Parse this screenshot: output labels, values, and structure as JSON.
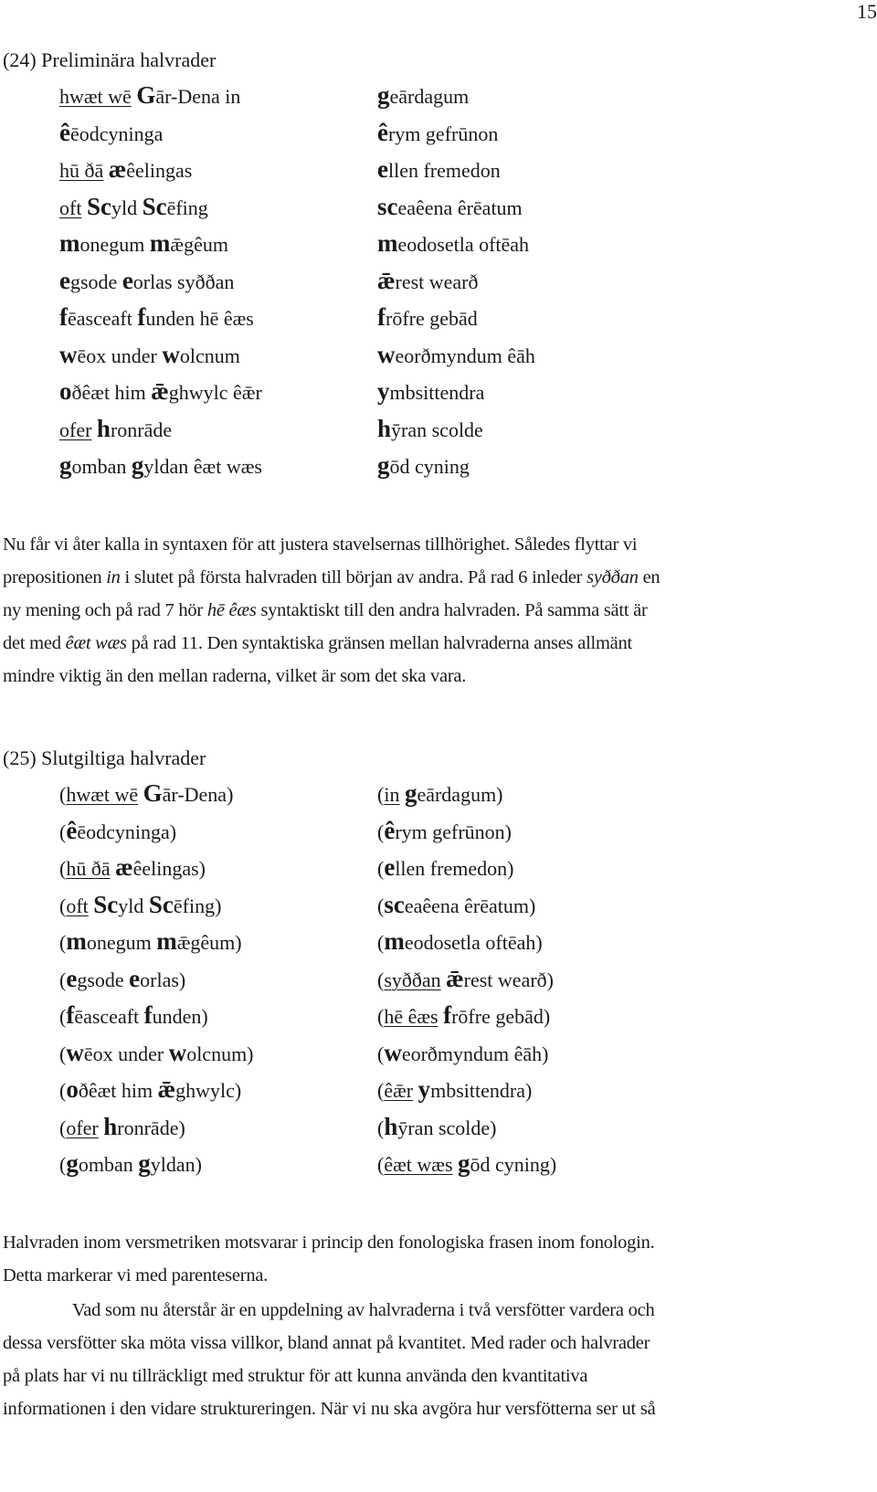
{
  "page_number": "15",
  "example_24": {
    "title": "(24) Preliminära halvrader",
    "rows": [
      {
        "a": [
          [
            "u",
            "hwæt wē"
          ],
          [
            "t",
            " "
          ],
          [
            "b",
            "G"
          ],
          [
            "t",
            "ār-Dena in"
          ]
        ],
        "b": [
          [
            "b",
            "g"
          ],
          [
            "t",
            "eārdagum"
          ]
        ]
      },
      {
        "a": [
          [
            "b",
            "ê"
          ],
          [
            "t",
            "ēodcyninga"
          ]
        ],
        "b": [
          [
            "b",
            "ê"
          ],
          [
            "t",
            "rym gefrūnon"
          ]
        ]
      },
      {
        "a": [
          [
            "u",
            "hū ðā"
          ],
          [
            "t",
            " "
          ],
          [
            "b",
            "æ"
          ],
          [
            "t",
            "êelingas"
          ]
        ],
        "b": [
          [
            "b",
            "e"
          ],
          [
            "t",
            "llen fremedon"
          ]
        ]
      },
      {
        "a": [
          [
            "u",
            "oft"
          ],
          [
            "t",
            " "
          ],
          [
            "b",
            "Sc"
          ],
          [
            "t",
            "yld "
          ],
          [
            "b",
            "Sc"
          ],
          [
            "t",
            "ēfing"
          ]
        ],
        "b": [
          [
            "b",
            "sc"
          ],
          [
            "t",
            "eaêena êrēatum"
          ]
        ]
      },
      {
        "a": [
          [
            "b",
            "m"
          ],
          [
            "t",
            "onegum "
          ],
          [
            "b",
            "m"
          ],
          [
            "t",
            "ǣgêum"
          ]
        ],
        "b": [
          [
            "b",
            "m"
          ],
          [
            "t",
            "eodosetla oftēah"
          ]
        ]
      },
      {
        "a": [
          [
            "b",
            "e"
          ],
          [
            "t",
            "gsode "
          ],
          [
            "b",
            "e"
          ],
          [
            "t",
            "orlas syððan"
          ]
        ],
        "b": [
          [
            "b",
            "ǣ"
          ],
          [
            "t",
            "rest wearð"
          ]
        ]
      },
      {
        "a": [
          [
            "b",
            "f"
          ],
          [
            "t",
            "ēasceaft "
          ],
          [
            "b",
            "f"
          ],
          [
            "t",
            "unden hē êæs"
          ]
        ],
        "b": [
          [
            "b",
            "f"
          ],
          [
            "t",
            "rōfre gebād"
          ]
        ]
      },
      {
        "a": [
          [
            "b",
            "w"
          ],
          [
            "t",
            "ēox under "
          ],
          [
            "b",
            "w"
          ],
          [
            "t",
            "olcnum"
          ]
        ],
        "b": [
          [
            "b",
            "w"
          ],
          [
            "t",
            "eorðmyndum êāh"
          ]
        ]
      },
      {
        "a": [
          [
            "b",
            "o"
          ],
          [
            "t",
            "ðêæt him "
          ],
          [
            "b",
            "ǣ"
          ],
          [
            "t",
            "ghwylc êǣr"
          ]
        ],
        "b": [
          [
            "b",
            "y"
          ],
          [
            "t",
            "mbsittendra"
          ]
        ]
      },
      {
        "a": [
          [
            "u",
            "ofer"
          ],
          [
            "t",
            " "
          ],
          [
            "b",
            "h"
          ],
          [
            "t",
            "ronrāde"
          ]
        ],
        "b": [
          [
            "b",
            "h"
          ],
          [
            "t",
            "ȳran scolde"
          ]
        ]
      },
      {
        "a": [
          [
            "b",
            "g"
          ],
          [
            "t",
            "omban "
          ],
          [
            "b",
            "g"
          ],
          [
            "t",
            "yldan êæt wæs"
          ]
        ],
        "b": [
          [
            "b",
            "g"
          ],
          [
            "t",
            "ōd cyning"
          ]
        ]
      }
    ]
  },
  "paragraph_1": {
    "lines": [
      [
        [
          "t",
          "Nu får vi åter kalla in syntaxen för att justera stavelsernas tillhörighet. Således flyttar vi"
        ]
      ],
      [
        [
          "t",
          "prepositionen "
        ],
        [
          "i",
          "in"
        ],
        [
          "t",
          " i slutet på första halvraden till början av andra. På rad 6 inleder "
        ],
        [
          "i",
          "syððan"
        ],
        [
          "t",
          " en"
        ]
      ],
      [
        [
          "t",
          "ny mening och på rad 7 hör "
        ],
        [
          "i",
          "hē êæs"
        ],
        [
          "t",
          " syntaktiskt till den andra halvraden. På samma sätt är"
        ]
      ],
      [
        [
          "t",
          "det med "
        ],
        [
          "i",
          "êæt wæs"
        ],
        [
          "t",
          " på rad 11. Den syntaktiska gränsen mellan halvraderna anses allmänt"
        ]
      ],
      [
        [
          "t",
          "mindre viktig än den mellan raderna, vilket är som det ska vara."
        ]
      ]
    ]
  },
  "example_25": {
    "title": "(25) Slutgiltiga halvrader",
    "rows": [
      {
        "a": [
          [
            "t",
            "("
          ],
          [
            "u",
            "hwæt wē"
          ],
          [
            "t",
            " "
          ],
          [
            "b",
            "G"
          ],
          [
            "t",
            "ār-Dena)"
          ]
        ],
        "b": [
          [
            "t",
            "("
          ],
          [
            "u",
            "in"
          ],
          [
            "t",
            " "
          ],
          [
            "b",
            "g"
          ],
          [
            "t",
            "eārdagum)"
          ]
        ]
      },
      {
        "a": [
          [
            "t",
            "("
          ],
          [
            "b",
            "ê"
          ],
          [
            "t",
            "ēodcyninga)"
          ]
        ],
        "b": [
          [
            "t",
            "("
          ],
          [
            "b",
            "ê"
          ],
          [
            "t",
            "rym gefrūnon)"
          ]
        ]
      },
      {
        "a": [
          [
            "t",
            "("
          ],
          [
            "u",
            "hū ðā"
          ],
          [
            "t",
            " "
          ],
          [
            "b",
            "æ"
          ],
          [
            "t",
            "êelingas)"
          ]
        ],
        "b": [
          [
            "t",
            "("
          ],
          [
            "b",
            "e"
          ],
          [
            "t",
            "llen fremedon)"
          ]
        ]
      },
      {
        "a": [
          [
            "t",
            "("
          ],
          [
            "u",
            "oft"
          ],
          [
            "t",
            " "
          ],
          [
            "b",
            "Sc"
          ],
          [
            "t",
            "yld "
          ],
          [
            "b",
            "Sc"
          ],
          [
            "t",
            "ēfing)"
          ]
        ],
        "b": [
          [
            "t",
            "("
          ],
          [
            "b",
            "sc"
          ],
          [
            "t",
            "eaêena êrēatum)"
          ]
        ]
      },
      {
        "a": [
          [
            "t",
            "("
          ],
          [
            "b",
            "m"
          ],
          [
            "t",
            "onegum "
          ],
          [
            "b",
            "m"
          ],
          [
            "t",
            "ǣgêum)"
          ]
        ],
        "b": [
          [
            "t",
            "("
          ],
          [
            "b",
            "m"
          ],
          [
            "t",
            "eodosetla oftēah)"
          ]
        ]
      },
      {
        "a": [
          [
            "t",
            "("
          ],
          [
            "b",
            "e"
          ],
          [
            "t",
            "gsode "
          ],
          [
            "b",
            "e"
          ],
          [
            "t",
            "orlas)"
          ]
        ],
        "b": [
          [
            "t",
            "("
          ],
          [
            "u",
            "syððan"
          ],
          [
            "t",
            " "
          ],
          [
            "b",
            "ǣ"
          ],
          [
            "t",
            "rest wearð)"
          ]
        ]
      },
      {
        "a": [
          [
            "t",
            "("
          ],
          [
            "b",
            "f"
          ],
          [
            "t",
            "ēasceaft "
          ],
          [
            "b",
            "f"
          ],
          [
            "t",
            "unden)"
          ]
        ],
        "b": [
          [
            "t",
            "("
          ],
          [
            "u",
            "hē êæs"
          ],
          [
            "t",
            " "
          ],
          [
            "b",
            "f"
          ],
          [
            "t",
            "rōfre gebād)"
          ]
        ]
      },
      {
        "a": [
          [
            "t",
            "("
          ],
          [
            "b",
            "w"
          ],
          [
            "t",
            "ēox under "
          ],
          [
            "b",
            "w"
          ],
          [
            "t",
            "olcnum)"
          ]
        ],
        "b": [
          [
            "t",
            "("
          ],
          [
            "b",
            "w"
          ],
          [
            "t",
            "eorðmyndum êāh)"
          ]
        ]
      },
      {
        "a": [
          [
            "t",
            "("
          ],
          [
            "b",
            "o"
          ],
          [
            "t",
            "ðêæt him "
          ],
          [
            "b",
            "ǣ"
          ],
          [
            "t",
            "ghwylc)"
          ]
        ],
        "b": [
          [
            "t",
            "("
          ],
          [
            "u",
            "êǣr"
          ],
          [
            "t",
            " "
          ],
          [
            "b",
            "y"
          ],
          [
            "t",
            "mbsittendra)"
          ]
        ]
      },
      {
        "a": [
          [
            "t",
            "("
          ],
          [
            "u",
            "ofer"
          ],
          [
            "t",
            " "
          ],
          [
            "b",
            "h"
          ],
          [
            "t",
            "ronrāde)"
          ]
        ],
        "b": [
          [
            "t",
            "("
          ],
          [
            "b",
            "h"
          ],
          [
            "t",
            "ȳran scolde)"
          ]
        ]
      },
      {
        "a": [
          [
            "t",
            "("
          ],
          [
            "b",
            "g"
          ],
          [
            "t",
            "omban "
          ],
          [
            "b",
            "g"
          ],
          [
            "t",
            "yldan)"
          ]
        ],
        "b": [
          [
            "t",
            "("
          ],
          [
            "u",
            "êæt wæs"
          ],
          [
            "t",
            " "
          ],
          [
            "b",
            "g"
          ],
          [
            "t",
            "ōd cyning)"
          ]
        ]
      }
    ]
  },
  "paragraph_2": {
    "lines": [
      [
        [
          "t",
          "Halvraden inom versmetriken motsvarar i princip den fonologiska frasen inom fonologin."
        ]
      ],
      [
        [
          "t",
          "Detta markerar vi med parenteserna."
        ]
      ]
    ]
  },
  "paragraph_3": {
    "lines": [
      [
        [
          "t",
          "Vad som nu återstår är en uppdelning av halvraderna i två versfötter vardera och"
        ]
      ],
      [
        [
          "t",
          "dessa versfötter ska möta vissa villkor, bland annat på kvantitet. Med rader och halvrader"
        ]
      ],
      [
        [
          "t",
          "på plats har vi nu tillräckligt med struktur för att kunna använda den kvantitativa"
        ]
      ],
      [
        [
          "t",
          "informationen i den vidare struktureringen. När vi nu ska avgöra hur versfötterna ser ut så"
        ]
      ]
    ]
  }
}
